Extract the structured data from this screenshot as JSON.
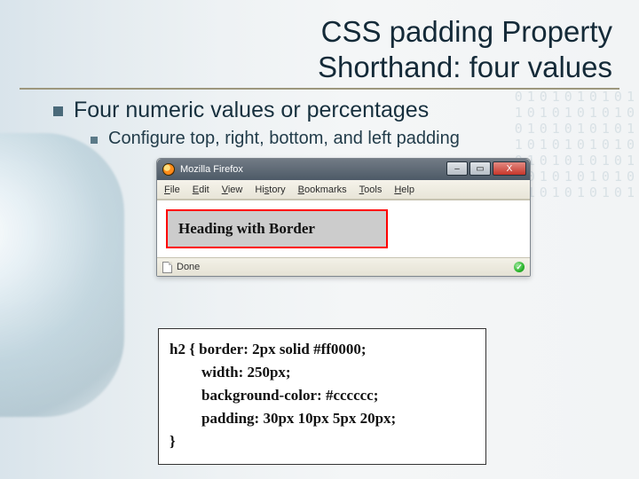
{
  "title_line1": "CSS padding Property",
  "title_line2": "Shorthand: four values",
  "bullet1": "Four numeric values or percentages",
  "bullet2": "Configure top, right, bottom, and left padding",
  "browser": {
    "app_name": "Mozilla Firefox",
    "menu": {
      "file": "File",
      "edit": "Edit",
      "view": "View",
      "history": "History",
      "bookmarks": "Bookmarks",
      "tools": "Tools",
      "help": "Help"
    },
    "page_heading": "Heading with Border",
    "status_text": "Done",
    "window_controls": {
      "min": "–",
      "max": "▭",
      "close": "X"
    },
    "ok_glyph": "✓"
  },
  "code": {
    "l1": "h2 { border: 2px solid #ff0000;",
    "l2": "width: 250px;",
    "l3": "background-color: #cccccc;",
    "l4": "padding: 30px 10px 5px 20px;",
    "l5": "}"
  },
  "decor_binary": "0101010101\n1010101010\n0101010101\n1010101010\n0101010101\n1010101010\n0101010101"
}
